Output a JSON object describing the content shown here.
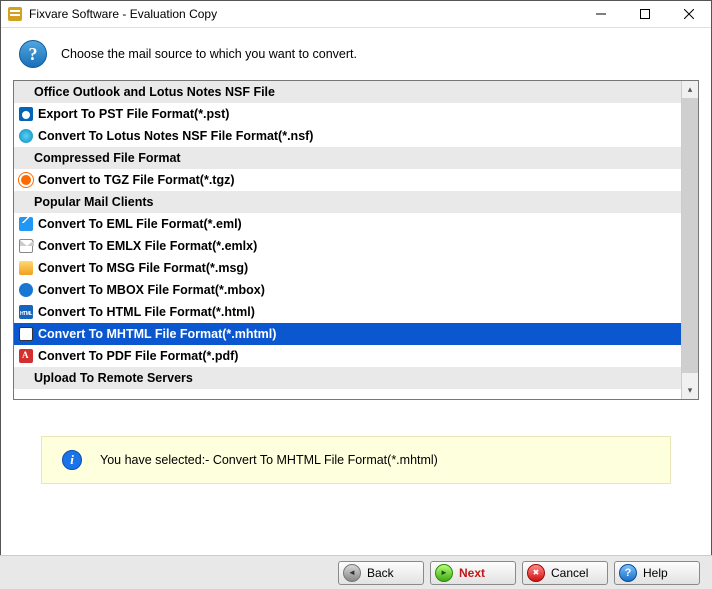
{
  "window": {
    "title": "Fixvare Software - Evaluation Copy"
  },
  "instruction": "Choose the mail source to which you want to convert.",
  "groups": [
    {
      "header": "Office Outlook and Lotus Notes NSF File",
      "items": [
        {
          "icon": "outlook",
          "label": "Export To PST File Format(*.pst)",
          "selected": false
        },
        {
          "icon": "nsf",
          "label": "Convert To Lotus Notes NSF File Format(*.nsf)",
          "selected": false
        }
      ]
    },
    {
      "header": "Compressed File Format",
      "items": [
        {
          "icon": "tgz",
          "label": "Convert to TGZ File Format(*.tgz)",
          "selected": false
        }
      ]
    },
    {
      "header": "Popular Mail Clients",
      "items": [
        {
          "icon": "eml",
          "label": "Convert To EML File Format(*.eml)",
          "selected": false
        },
        {
          "icon": "emlx",
          "label": "Convert To EMLX File Format(*.emlx)",
          "selected": false
        },
        {
          "icon": "msg",
          "label": "Convert To MSG File Format(*.msg)",
          "selected": false
        },
        {
          "icon": "mbox",
          "label": "Convert To MBOX File Format(*.mbox)",
          "selected": false
        },
        {
          "icon": "html",
          "label": "Convert To HTML File Format(*.html)",
          "selected": false
        },
        {
          "icon": "mhtml",
          "label": "Convert To MHTML File Format(*.mhtml)",
          "selected": true
        },
        {
          "icon": "pdf",
          "label": "Convert To PDF File Format(*.pdf)",
          "selected": false
        }
      ]
    },
    {
      "header": "Upload To Remote Servers",
      "items": []
    }
  ],
  "status": {
    "prefix": "You have selected:- ",
    "value": "Convert To MHTML File Format(*.mhtml)"
  },
  "buttons": {
    "back": "Back",
    "next": "Next",
    "cancel": "Cancel",
    "help": "Help"
  }
}
